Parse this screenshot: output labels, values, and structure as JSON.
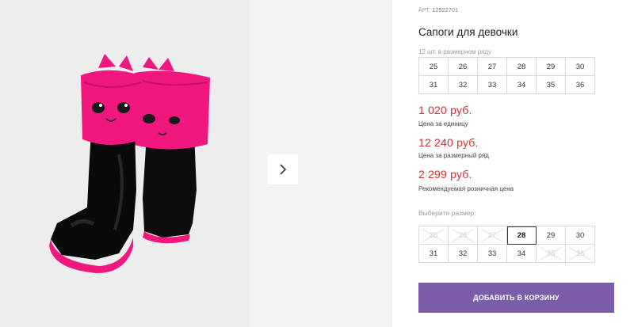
{
  "product": {
    "article_label": "АРТ.",
    "article_number": "12522701",
    "title": "Сапоги для девочки",
    "image_alt": "boots-photo"
  },
  "size_row": {
    "label": "12 шт. в размерном ряду",
    "sizes": [
      "25",
      "26",
      "27",
      "28",
      "29",
      "30",
      "31",
      "32",
      "33",
      "34",
      "35",
      "36"
    ]
  },
  "prices": [
    {
      "value": "1 020 руб.",
      "note": "Цена за единицу"
    },
    {
      "value": "12 240 руб.",
      "note": "Цена за размерный ряд"
    },
    {
      "value": "2 299 руб.",
      "note": "Рекомендуемая розничная цена"
    }
  ],
  "size_select": {
    "label": "Выберите размер:",
    "sizes": [
      "25",
      "26",
      "27",
      "28",
      "29",
      "30",
      "31",
      "32",
      "33",
      "34",
      "35",
      "36"
    ],
    "disabled": [
      "25",
      "26",
      "27",
      "35",
      "36"
    ],
    "selected": "28"
  },
  "add_to_cart_label": "Добавить в корзину",
  "colors": {
    "price": "#d32f2f",
    "button": "#7b5ea7",
    "boot_body": "#101010",
    "boot_cuff": "#f0177f"
  },
  "icons": {
    "next": "chevron-right-icon"
  }
}
